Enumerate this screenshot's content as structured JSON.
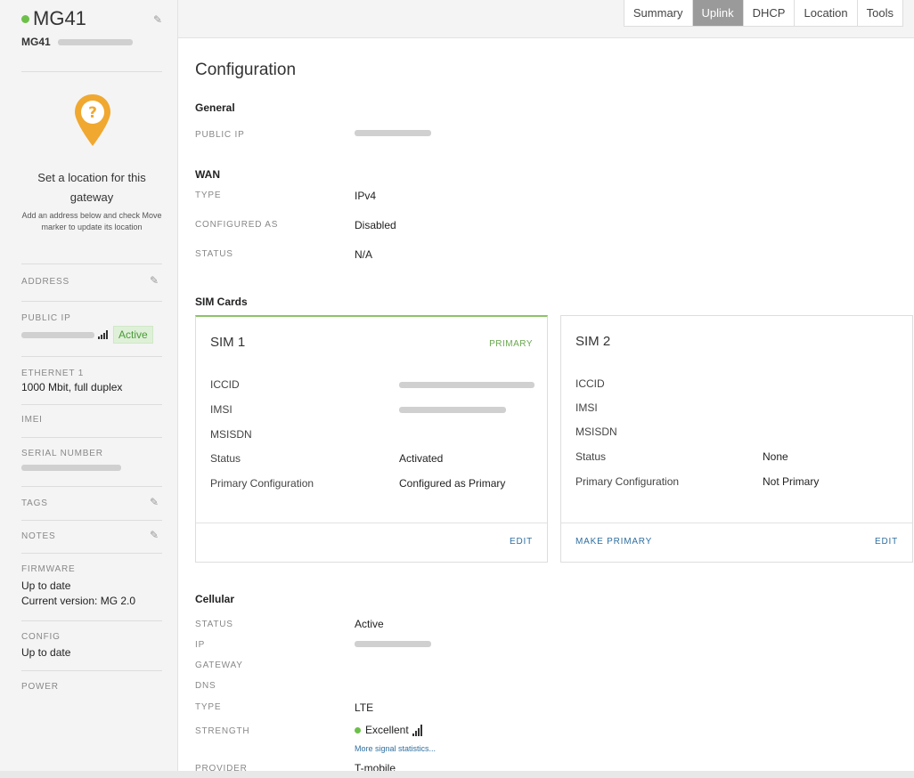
{
  "sidebar": {
    "title": "MG41",
    "subtitle": "MG41",
    "location_title": "Set a location for this gateway",
    "location_desc": "Add an address below and check Move marker to update its location",
    "address_label": "ADDRESS",
    "public_ip_label": "PUBLIC IP",
    "public_ip_status": "Active",
    "ethernet_label": "ETHERNET 1",
    "ethernet_value": "1000 Mbit, full duplex",
    "imei_label": "IMEI",
    "serial_label": "SERIAL NUMBER",
    "tags_label": "TAGS",
    "notes_label": "NOTES",
    "firmware_label": "FIRMWARE",
    "firmware_status": "Up to date",
    "firmware_version": "Current version: MG 2.0",
    "config_label": "CONFIG",
    "config_value": "Up to date",
    "power_label": "POWER",
    "status_color": "#6cc04a"
  },
  "tabs": [
    {
      "label": "Summary"
    },
    {
      "label": "Uplink",
      "active": true
    },
    {
      "label": "DHCP"
    },
    {
      "label": "Location"
    },
    {
      "label": "Tools"
    }
  ],
  "main": {
    "title": "Configuration",
    "general": {
      "heading": "General",
      "public_ip_label": "PUBLIC IP"
    },
    "wan": {
      "heading": "WAN",
      "type_label": "TYPE",
      "type_value": "IPv4",
      "configured_label": "CONFIGURED AS",
      "configured_value": "Disabled",
      "status_label": "STATUS",
      "status_value": "N/A"
    },
    "sim_heading": "SIM Cards",
    "sim1": {
      "title": "SIM 1",
      "tag": "PRIMARY",
      "iccid_label": "ICCID",
      "imsi_label": "IMSI",
      "msisdn_label": "MSISDN",
      "status_label": "Status",
      "status_value": "Activated",
      "primary_label": "Primary Configuration",
      "primary_value": "Configured as Primary",
      "edit": "EDIT"
    },
    "sim2": {
      "title": "SIM 2",
      "iccid_label": "ICCID",
      "imsi_label": "IMSI",
      "msisdn_label": "MSISDN",
      "status_label": "Status",
      "status_value": "None",
      "primary_label": "Primary Configuration",
      "primary_value": "Not Primary",
      "make_primary": "MAKE PRIMARY",
      "edit": "EDIT"
    },
    "cellular": {
      "heading": "Cellular",
      "status_label": "STATUS",
      "status_value": "Active",
      "ip_label": "IP",
      "gateway_label": "GATEWAY",
      "dns_label": "DNS",
      "type_label": "TYPE",
      "type_value": "LTE",
      "strength_label": "STRENGTH",
      "strength_value": "Excellent",
      "more_link": "More signal statistics...",
      "provider_label": "PROVIDER",
      "provider_value": "T-mobile"
    }
  },
  "colors": {
    "accent_green": "#6cc04a",
    "pin_orange": "#f0a830",
    "link_blue": "#2f6f9f",
    "active_tab": "#9a9a9a"
  }
}
